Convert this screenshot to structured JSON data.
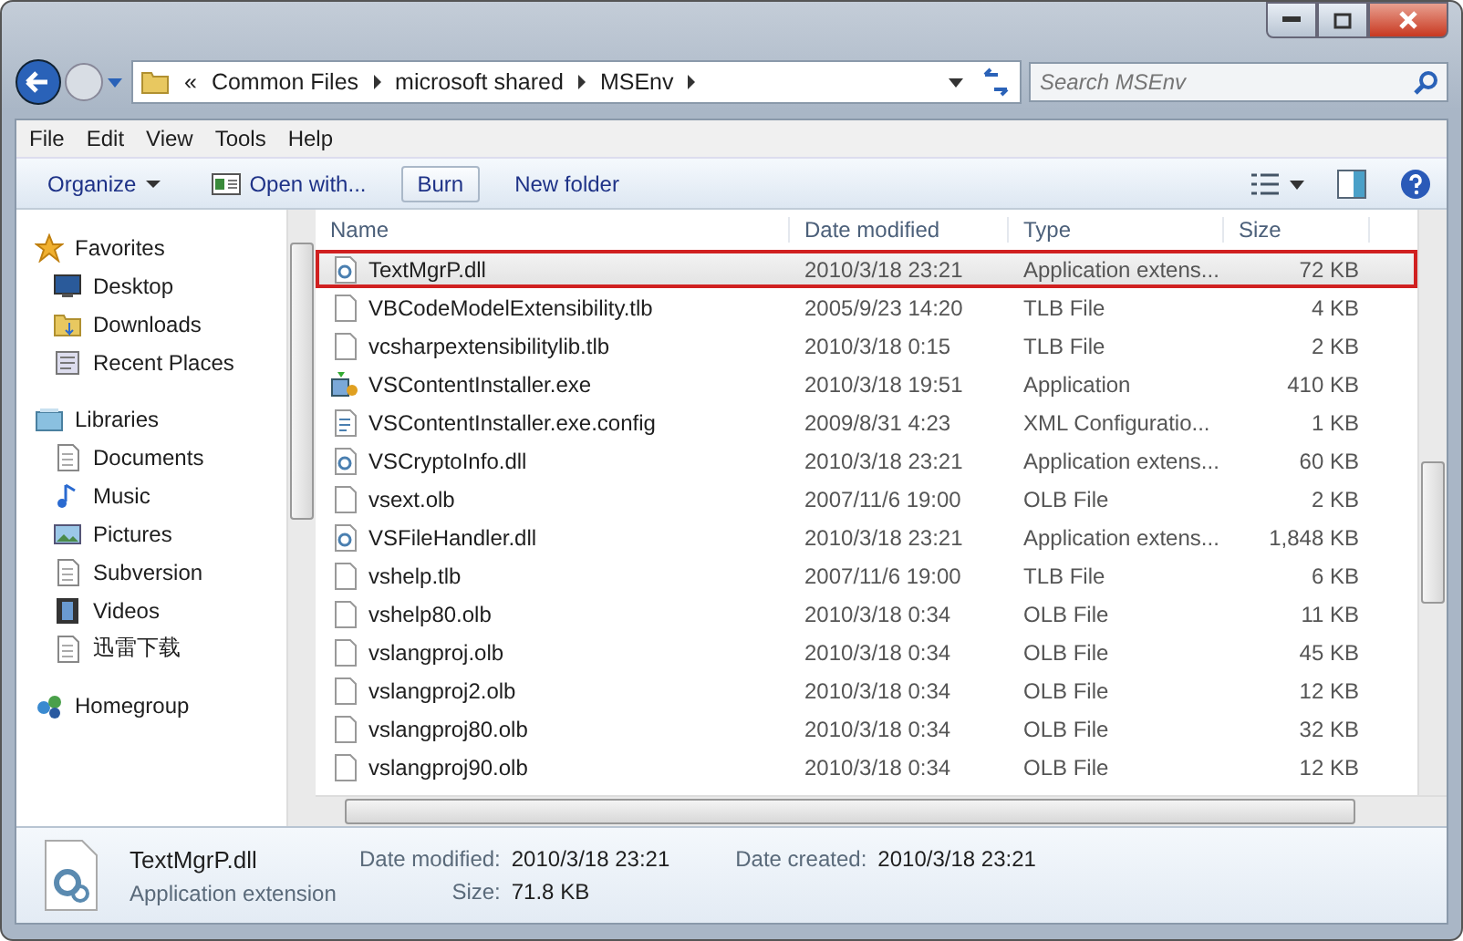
{
  "window": {
    "search_placeholder": "Search MSEnv"
  },
  "breadcrumb": [
    {
      "label": "«"
    },
    {
      "label": "Common Files"
    },
    {
      "label": "microsoft shared"
    },
    {
      "label": "MSEnv"
    }
  ],
  "menu": [
    "File",
    "Edit",
    "View",
    "Tools",
    "Help"
  ],
  "toolbar": [
    {
      "label": "Organize",
      "kind": "dropdown",
      "selected": false
    },
    {
      "label": "Open with...",
      "kind": "icon",
      "selected": false
    },
    {
      "label": "Burn",
      "kind": "plain",
      "selected": true
    },
    {
      "label": "New folder",
      "kind": "plain",
      "selected": false
    }
  ],
  "sidebar": [
    {
      "label": "Favorites",
      "kind": "star",
      "children": [
        {
          "label": "Desktop",
          "kind": "desktop"
        },
        {
          "label": "Downloads",
          "kind": "folder"
        },
        {
          "label": "Recent Places",
          "kind": "recent"
        }
      ]
    },
    {
      "label": "Libraries",
      "kind": "library",
      "children": [
        {
          "label": "Documents",
          "kind": "doc"
        },
        {
          "label": "Music",
          "kind": "music"
        },
        {
          "label": "Pictures",
          "kind": "picture"
        },
        {
          "label": "Subversion",
          "kind": "doc"
        },
        {
          "label": "Videos",
          "kind": "video"
        },
        {
          "label": "迅雷下载",
          "kind": "doc"
        }
      ]
    },
    {
      "label": "Homegroup",
      "kind": "homegroup"
    }
  ],
  "table": {
    "columns": [
      "Name",
      "Date modified",
      "Type",
      "Size"
    ],
    "rows": [
      {
        "name": "TextMgrP.dll",
        "date": "2010/3/18 23:21",
        "type": "Application extens...",
        "size": "72 KB",
        "kind": "dll",
        "selected": true
      },
      {
        "name": "VBCodeModelExtensibility.tlb",
        "date": "2005/9/23 14:20",
        "type": "TLB File",
        "size": "4 KB",
        "kind": "blank",
        "selected": false
      },
      {
        "name": "vcsharpextensibilitylib.tlb",
        "date": "2010/3/18 0:15",
        "type": "TLB File",
        "size": "2 KB",
        "kind": "blank",
        "selected": false
      },
      {
        "name": "VSContentInstaller.exe",
        "date": "2010/3/18 19:51",
        "type": "Application",
        "size": "410 KB",
        "kind": "exe",
        "selected": false
      },
      {
        "name": "VSContentInstaller.exe.config",
        "date": "2009/8/31 4:23",
        "type": "XML Configuratio...",
        "size": "1 KB",
        "kind": "config",
        "selected": false
      },
      {
        "name": "VSCryptoInfo.dll",
        "date": "2010/3/18 23:21",
        "type": "Application extens...",
        "size": "60 KB",
        "kind": "dll",
        "selected": false
      },
      {
        "name": "vsext.olb",
        "date": "2007/11/6 19:00",
        "type": "OLB File",
        "size": "2 KB",
        "kind": "blank",
        "selected": false
      },
      {
        "name": "VSFileHandler.dll",
        "date": "2010/3/18 23:21",
        "type": "Application extens...",
        "size": "1,848 KB",
        "kind": "dll",
        "selected": false
      },
      {
        "name": "vshelp.tlb",
        "date": "2007/11/6 19:00",
        "type": "TLB File",
        "size": "6 KB",
        "kind": "blank",
        "selected": false
      },
      {
        "name": "vshelp80.olb",
        "date": "2010/3/18 0:34",
        "type": "OLB File",
        "size": "11 KB",
        "kind": "blank",
        "selected": false
      },
      {
        "name": "vslangproj.olb",
        "date": "2010/3/18 0:34",
        "type": "OLB File",
        "size": "45 KB",
        "kind": "blank",
        "selected": false
      },
      {
        "name": "vslangproj2.olb",
        "date": "2010/3/18 0:34",
        "type": "OLB File",
        "size": "12 KB",
        "kind": "blank",
        "selected": false
      },
      {
        "name": "vslangproj80.olb",
        "date": "2010/3/18 0:34",
        "type": "OLB File",
        "size": "32 KB",
        "kind": "blank",
        "selected": false
      },
      {
        "name": "vslangproj90.olb",
        "date": "2010/3/18 0:34",
        "type": "OLB File",
        "size": "12 KB",
        "kind": "blank",
        "selected": false
      }
    ]
  },
  "details": {
    "name": "TextMgrP.dll",
    "type": "Application extension",
    "fields": [
      {
        "label": "Date modified:",
        "value": "2010/3/18 23:21"
      },
      {
        "label": "Date created:",
        "value": "2010/3/18 23:21"
      },
      {
        "label": "Size:",
        "value": "71.8 KB"
      }
    ]
  }
}
